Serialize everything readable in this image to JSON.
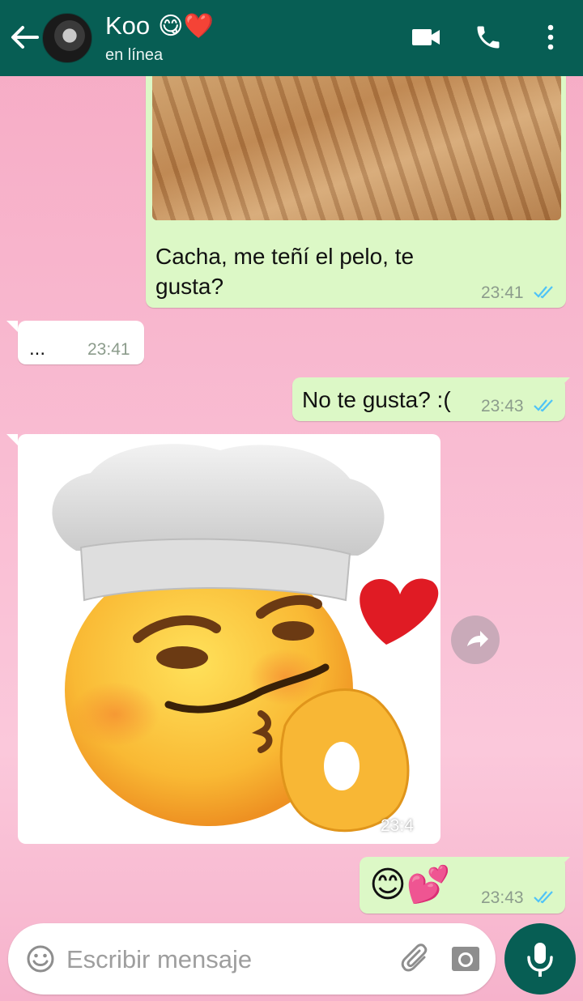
{
  "header": {
    "contact_name": "Koo",
    "contact_emojis": "😋❤️",
    "status": "en línea"
  },
  "messages": [
    {
      "direction": "outgoing",
      "type": "image_with_caption",
      "text": "Cacha, me teñí el pelo, te gusta?",
      "time": "23:41",
      "read": true
    },
    {
      "direction": "incoming",
      "type": "text",
      "text": "...",
      "time": "23:41"
    },
    {
      "direction": "outgoing",
      "type": "text",
      "text": "No te gusta? :(",
      "time": "23:43",
      "read": true
    },
    {
      "direction": "incoming",
      "type": "sticker",
      "sticker": "chef-kiss-emoji",
      "time": "23:4"
    },
    {
      "direction": "outgoing",
      "type": "text",
      "text": "😊💕",
      "time": "23:43",
      "read": true
    }
  ],
  "input": {
    "placeholder": "Escribir mensaje"
  },
  "icons": [
    "back-arrow-icon",
    "video-call-icon",
    "phone-icon",
    "more-vert-icon",
    "forward-icon",
    "emoji-icon",
    "attach-icon",
    "camera-icon",
    "mic-icon"
  ],
  "colors": {
    "header": "#075e54",
    "outgoing_bubble": "#dcf8c6",
    "incoming_bubble": "#ffffff",
    "read_ticks": "#4fc3f7"
  }
}
